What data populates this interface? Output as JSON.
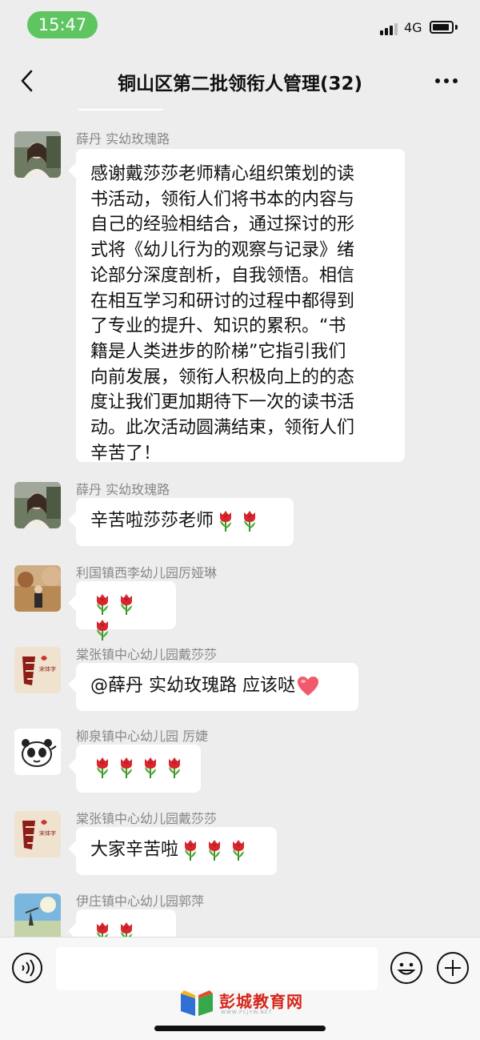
{
  "status_bar": {
    "time": "15:47",
    "network": "4G",
    "colors": {
      "time_pill": "#5ec561"
    }
  },
  "nav": {
    "title": "铜山区第二批领衔人管理(32)",
    "back_icon": "chevron-left-icon",
    "more_icon": "more-dots-icon"
  },
  "messages": [
    {
      "sender": "薛丹 实幼玫瑰路",
      "lines": [
        "感谢戴莎莎老师精心组织策划的读",
        "书活动，领衔人们将书本的内容与",
        "自己的经验相结合，通过探讨的形",
        "式将《幼儿行为的观察与记录》绪",
        "论部分深度剖析，自我领悟。相信",
        "在相互学习和研讨的过程中都得到",
        "了专业的提升、知识的累积。“书",
        "籍是人类进步的阶梯”它指引我们",
        "向前发展，领衔人积极向上的的态",
        "度让我们更加期待下一次的读书活",
        "动。此次活动圆满结束，领衔人们",
        "辛苦了！"
      ]
    },
    {
      "sender": "薛丹 实幼玫瑰路",
      "text": "辛苦啦莎莎老师",
      "tulips": 2
    },
    {
      "sender": "利国镇西李幼儿园厉娅琳",
      "text": "",
      "tulips": 3
    },
    {
      "sender": "棠张镇中心幼儿园戴莎莎",
      "text": "@薛丹 实幼玫瑰路 应该哒",
      "heart": true,
      "avatar_seal": "宋体字"
    },
    {
      "sender": "柳泉镇中心幼儿园 厉婕",
      "text": "",
      "tulips": 4
    },
    {
      "sender": "棠张镇中心幼儿园戴莎莎",
      "text": "大家辛苦啦",
      "tulips": 3,
      "avatar_seal": "宋体字"
    },
    {
      "sender": "伊庄镇中心幼儿园郭萍",
      "text": "",
      "tulips": 3
    }
  ],
  "input_bar": {
    "voice_icon": "voice-icon",
    "emoji_icon": "emoji-icon",
    "plus_icon": "plus-icon",
    "input_value": ""
  },
  "watermark": {
    "text": "彭城教育网",
    "subtext": "WWW.PCJYW.NET"
  }
}
